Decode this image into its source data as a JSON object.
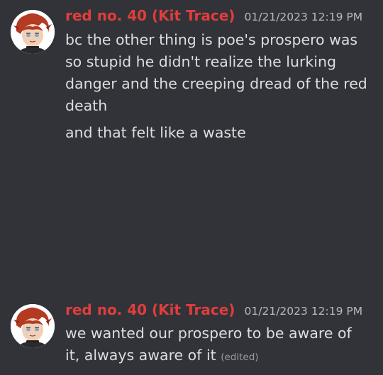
{
  "messages": [
    {
      "author": "red no. 40 (Kit Trace)",
      "timestamp": "01/21/2023 12:19 PM",
      "lines": [
        "bc the other thing is poe's prospero was so stupid he didn't realize the lurking danger and the creeping dread of the red death",
        "and that felt like  a waste"
      ]
    },
    {
      "author": "red no. 40 (Kit Trace)",
      "timestamp": "01/21/2023 12:19 PM",
      "lines": [
        "we wanted our prospero to be aware of it, always aware of it"
      ],
      "edited_label": "(edited)"
    }
  ],
  "colors": {
    "background": "#313338",
    "author": "#e03d3d",
    "text": "#dbdee1",
    "muted": "#949ba4"
  }
}
